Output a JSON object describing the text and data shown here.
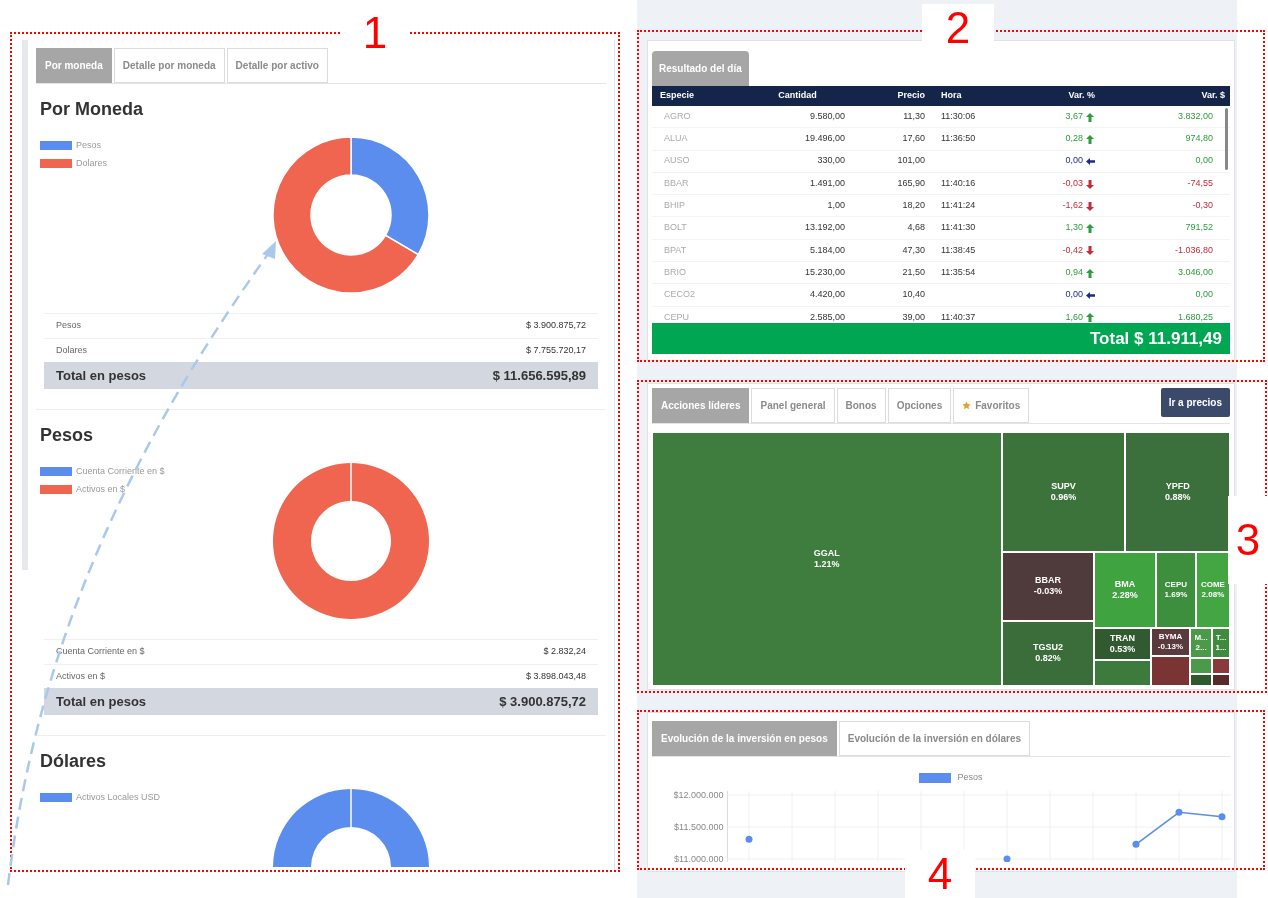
{
  "left_panel": {
    "tabs": [
      {
        "label": "Por moneda",
        "selected": true
      },
      {
        "label": "Detalle por moneda",
        "selected": false
      },
      {
        "label": "Detalle por activo",
        "selected": false
      }
    ],
    "sections": [
      {
        "title": "Por Moneda",
        "legend": [
          {
            "color": "#5b8def"
          },
          {
            "color": "#ef6550"
          }
        ],
        "chart_data": {
          "type": "donut",
          "categories": [
            "Pesos",
            "Dolares"
          ],
          "values": [
            33.47,
            66.53
          ]
        },
        "rows": [
          {
            "label": "Pesos",
            "amount": "$ 3.900.875,72"
          },
          {
            "label": "Dolares",
            "amount": "$ 7.755.720,17"
          }
        ],
        "total": {
          "label": "Total en pesos",
          "amount": "$ 11.656.595,89"
        }
      },
      {
        "title": "Pesos",
        "legend": [
          {
            "label": "Cuenta Corriente en $",
            "color": "#5b8def"
          },
          {
            "label": "Activos en $",
            "color": "#ef6550"
          }
        ],
        "rows": [
          {
            "label": "Cuenta Corriente en $",
            "amount": "$ 2.832,24"
          },
          {
            "label": "Activos en $",
            "amount": "$ 3.898.043,48"
          }
        ],
        "total": {
          "label": "Total en pesos",
          "amount": "$ 3.900.875,72"
        }
      },
      {
        "title": "Dólares",
        "legend": [
          {
            "label": "Activos Locales USD",
            "color": "#5b8def"
          }
        ]
      }
    ]
  },
  "results_panel": {
    "tab": {
      "label": "Resultado del día",
      "selected": true
    },
    "columns": [
      "Especie",
      "Cantidad",
      "Precio",
      "Hora",
      "Var. %",
      "Var. $"
    ],
    "rows": [
      {
        "especie": "AGRO",
        "cantidad": "9.580,00",
        "precio": "11,30",
        "hora": "11:30:06",
        "var_pct": "3,67",
        "kind": "up",
        "var_amount": "3.832,00"
      },
      {
        "especie": "ALUA",
        "cantidad": "19.496,00",
        "precio": "17,60",
        "hora": "11:36:50",
        "var_pct": "0,28",
        "kind": "up",
        "var_amount": "974,80"
      },
      {
        "especie": "AUSO",
        "cantidad": "330,00",
        "precio": "101,00",
        "var_pct": "0,00",
        "kind": "flat",
        "var_amount": "0,00"
      },
      {
        "especie": "BBAR",
        "cantidad": "1.491,00",
        "precio": "165,90",
        "hora": "11:40:16",
        "var_pct": "-0,03",
        "kind": "down",
        "var_amount": "-74,55"
      },
      {
        "especie": "BHIP",
        "cantidad": "1,00",
        "precio": "18,20",
        "hora": "11:41:24",
        "var_pct": "-1,62",
        "kind": "down",
        "var_amount": "-0,30"
      },
      {
        "especie": "BOLT",
        "cantidad": "13.192,00",
        "precio": "4,68",
        "hora": "11:41:30",
        "var_pct": "1,30",
        "kind": "up",
        "var_amount": "791,52"
      },
      {
        "especie": "BPAT",
        "cantidad": "5.184,00",
        "precio": "47,30",
        "hora": "11:38:45",
        "var_pct": "-0,42",
        "kind": "down",
        "var_amount": "-1.036,80"
      },
      {
        "especie": "BRIO",
        "cantidad": "15.230,00",
        "precio": "21,50",
        "hora": "11:35:54",
        "var_pct": "0,94",
        "kind": "up",
        "var_amount": "3.046,00"
      },
      {
        "especie": "CECO2",
        "cantidad": "4.420,00",
        "precio": "10,40",
        "var_pct": "0,00",
        "kind": "flat",
        "var_amount": "0,00"
      },
      {
        "especie": "CEPU",
        "cantidad": "2.585,00",
        "precio": "39,00",
        "hora": "11:40:37",
        "var_pct": "1,60",
        "kind": "up",
        "var_amount": "1.680,25"
      }
    ],
    "total": "Total $ 11.911,49"
  },
  "market_panel": {
    "tabs": [
      {
        "label": "Acciones líderes",
        "selected": true,
        "kind": "plain"
      },
      {
        "label": "Panel general",
        "selected": false,
        "kind": "plain"
      },
      {
        "label": "Bonos",
        "selected": false,
        "kind": "plain"
      },
      {
        "label": "Opciones",
        "selected": false,
        "kind": "plain"
      },
      {
        "label": "Favoritos",
        "selected": false,
        "kind": "star"
      }
    ],
    "button": "Ir a precios",
    "tiles": [
      {
        "ticker": "GGAL",
        "change": "1.21%",
        "color": "#3f7d3f"
      },
      {
        "ticker": "SUPV",
        "change": "0.96%",
        "color": "#3b733b"
      },
      {
        "ticker": "YPFD",
        "change": "0.88%",
        "color": "#3b6f3b"
      },
      {
        "ticker": "BBAR",
        "change": "-0.03%",
        "color": "#4f3b3b"
      },
      {
        "ticker": "TGSU2",
        "change": "0.82%",
        "color": "#3b6d3b"
      },
      {
        "ticker": "BMA",
        "change": "2.28%",
        "color": "#3fa43f"
      },
      {
        "ticker": "CEPU",
        "change": "1.69%",
        "color": "#3d8f3d"
      },
      {
        "ticker": "COME",
        "change": "2.08%",
        "color": "#43a643"
      },
      {
        "ticker": "TRAN",
        "change": "0.53%",
        "color": "#315a31"
      },
      {
        "ticker": "BYMA",
        "change": "-0.13%",
        "color": "#5a3a3c"
      },
      {
        "ticker": "M...",
        "change": "2...",
        "color": "#4a9a4a"
      },
      {
        "ticker": "T...",
        "change": "1...",
        "color": "#3f8a3f"
      },
      {
        "color": "#3d7a3d"
      },
      {
        "color": "#7a3434"
      },
      {
        "color": "#4a9a4a"
      },
      {
        "color": "#2f5a2f"
      },
      {
        "color": "#8a3a3a"
      },
      {
        "color": "#5a2a2a"
      }
    ]
  },
  "evolution_panel": {
    "tabs": [
      {
        "label": "Evolución de la inversión en pesos",
        "selected": true
      },
      {
        "label": "Evolución de la inversión en dólares",
        "selected": false
      }
    ],
    "chart_data": {
      "type": "line",
      "grid": true,
      "categories": [
        null,
        null,
        null,
        null,
        null,
        null,
        null,
        null,
        null,
        null,
        null,
        null
      ],
      "ylim": [
        10950000,
        12000000
      ],
      "yticks": [
        {
          "value": 12000000,
          "label": "$12.000.000"
        },
        {
          "value": 11500000,
          "label": "$11.500.000"
        },
        {
          "value": 11000000,
          "label": "$11.000.000"
        }
      ],
      "series": [
        {
          "name": "Pesos",
          "color": "#5b8def",
          "marker": "circle",
          "values": [
            11310000,
            null,
            null,
            null,
            null,
            null,
            11000000,
            null,
            null,
            11230000,
            11730000,
            11660000
          ]
        }
      ]
    }
  },
  "annotations": [
    {
      "label": "1"
    },
    {
      "label": "2"
    },
    {
      "label": "3"
    },
    {
      "label": "4"
    }
  ]
}
